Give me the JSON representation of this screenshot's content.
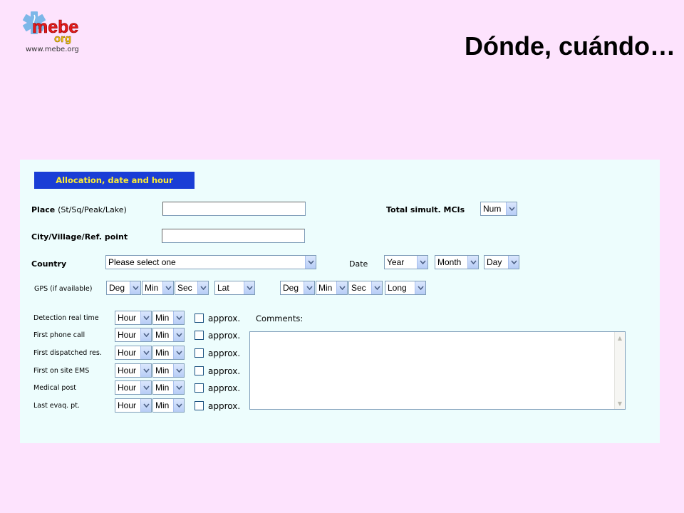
{
  "logo": {
    "text_main": "mebe",
    "text_sub": "org",
    "url": "www.mebe.org"
  },
  "slide": {
    "title": "Dónde, cuándo…"
  },
  "form": {
    "header": "Allocation, date and hour",
    "place_label_bold": "Place",
    "place_label_light": "(St/Sq/Peak/Lake)",
    "city_label": "City/Village/Ref. point",
    "country_label": "Country",
    "country_select": "Please select one",
    "total_label": "Total simult. MCIs",
    "total_select": "Num",
    "date_label": "Date",
    "date_selects": [
      "Year",
      "Month",
      "Day"
    ],
    "gps_label": "GPS (if available)",
    "gps_lat_selects": [
      "Deg",
      "Min",
      "Sec",
      "Lat"
    ],
    "gps_long_selects": [
      "Deg",
      "Min",
      "Sec",
      "Long"
    ],
    "comments_label": "Comments:",
    "time_rows": [
      {
        "label": "Detection real time",
        "hour": "Hour",
        "min": "Min",
        "approx": "approx."
      },
      {
        "label": "First phone call",
        "hour": "Hour",
        "min": "Min",
        "approx": "approx."
      },
      {
        "label": "First dispatched res.",
        "hour": "Hour",
        "min": "Min",
        "approx": "approx."
      },
      {
        "label": "First on site EMS",
        "hour": "Hour",
        "min": "Min",
        "approx": "approx."
      },
      {
        "label": "Medical post",
        "hour": "Hour",
        "min": "Min",
        "approx": "approx."
      },
      {
        "label": "Last evaq. pt.",
        "hour": "Hour",
        "min": "Min",
        "approx": "approx."
      }
    ]
  },
  "colors": {
    "slide_background": "#fde3fd",
    "panel_background": "#edfdfd",
    "header_background": "#1a3ed6",
    "header_text": "#ffee33"
  }
}
